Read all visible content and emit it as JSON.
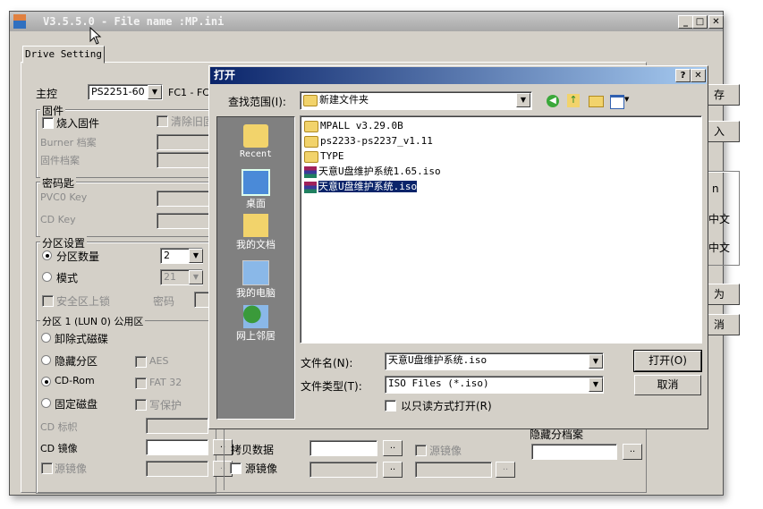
{
  "main": {
    "title": "V3.5.5.0 - File name :MP.ini",
    "tab": "Drive Setting",
    "controller_label": "主控",
    "controller_value": "PS2251-60",
    "fc_label": "FC1 - FC2",
    "firmware": {
      "group": "固件",
      "burn": "烧入固件",
      "clear_old": "清除旧固",
      "burner_file": "Burner 档案",
      "fw_file": "固件档案"
    },
    "keys": {
      "group": "密码匙",
      "pvc0": "PVC0 Key",
      "cd": "CD Key"
    },
    "partition": {
      "group": "分区设置",
      "count_label": "分区数量",
      "count_value": "2",
      "mode_label": "模式",
      "mode_value": "21",
      "secure_lock": "安全区上锁",
      "password": "密码"
    },
    "lun0": {
      "group": "分区 1 (LUN 0) 公用区",
      "removable": "卸除式磁碟",
      "hidden": "隐藏分区",
      "cdrom": "CD-Rom",
      "fixed": "固定磁盘",
      "aes": "AES",
      "fat32": "FAT 32",
      "write_protect": "写保护",
      "cd_label": "CD 标帜",
      "cd_image": "CD 镜像",
      "source_image": "源镜像",
      "browse": ".."
    },
    "lun1": {
      "copy_data": "拷贝数据",
      "source_image": "源镜像",
      "browse": ".."
    },
    "mid": {
      "source_image": "源镜像",
      "browse": ".."
    },
    "hidden_file": {
      "label": "隐藏分档案",
      "browse": ".."
    },
    "right_buttons": [
      "存",
      "入",
      "为",
      "消"
    ],
    "right_group": [
      "n",
      "中文",
      "中文"
    ]
  },
  "dialog": {
    "title": "打开",
    "look_in_label": "查找范围(I):",
    "look_in_value": "新建文件夹",
    "places": [
      "Recent",
      "桌面",
      "我的文档",
      "我的电脑",
      "网上邻居"
    ],
    "files": [
      {
        "name": "MPALL v3.29.0B",
        "type": "folder"
      },
      {
        "name": "ps2233-ps2237_v1.11",
        "type": "folder"
      },
      {
        "name": "TYPE",
        "type": "folder"
      },
      {
        "name": "天意U盘维护系统1.65.iso",
        "type": "iso"
      },
      {
        "name": "天意U盘维护系统.iso",
        "type": "iso",
        "selected": true
      }
    ],
    "filename_label": "文件名(N):",
    "filename_value": "天意U盘维护系统.iso",
    "filetype_label": "文件类型(T):",
    "filetype_value": "ISO Files (*.iso)",
    "readonly_label": "以只读方式打开(R)",
    "open_button": "打开(O)",
    "cancel_button": "取消",
    "help": "?",
    "close": "✕"
  },
  "window_controls": {
    "minimize": "_",
    "maximize": "□",
    "close": "✕"
  }
}
